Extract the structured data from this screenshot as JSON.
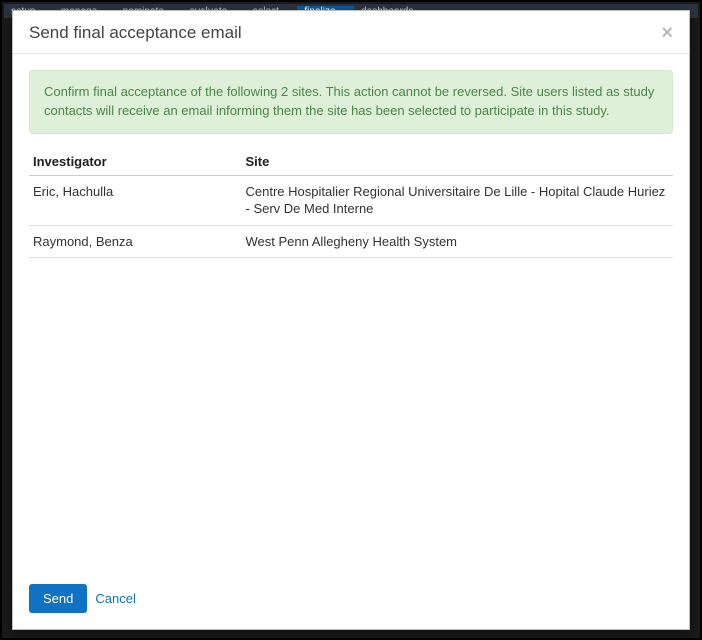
{
  "nav": {
    "items": [
      {
        "label": "setup",
        "chevron": true
      },
      {
        "label": "manage",
        "chevron": true
      },
      {
        "label": "nominate",
        "chevron": true
      },
      {
        "label": "evaluate",
        "chevron": true
      },
      {
        "label": "select",
        "chevron": true
      },
      {
        "label": "finalize",
        "chevron": true,
        "active": true
      },
      {
        "label": "dashboards",
        "chevron": true
      }
    ]
  },
  "modal": {
    "title": "Send final acceptance email",
    "close_label": "×",
    "alert": "Confirm final acceptance of the following 2 sites. This action cannot be reversed. Site users listed as study contacts will receive an email informing them the site has been selected to participate in this study.",
    "table": {
      "headers": {
        "investigator": "Investigator",
        "site": "Site"
      },
      "rows": [
        {
          "investigator": "Eric, Hachulla",
          "site": "Centre Hospitalier Regional Universitaire De Lille - Hopital Claude Huriez - Serv De Med Interne"
        },
        {
          "investigator": "Raymond, Benza",
          "site": "West Penn Allegheny Health System"
        }
      ]
    },
    "footer": {
      "send_label": "Send",
      "cancel_label": "Cancel"
    }
  }
}
